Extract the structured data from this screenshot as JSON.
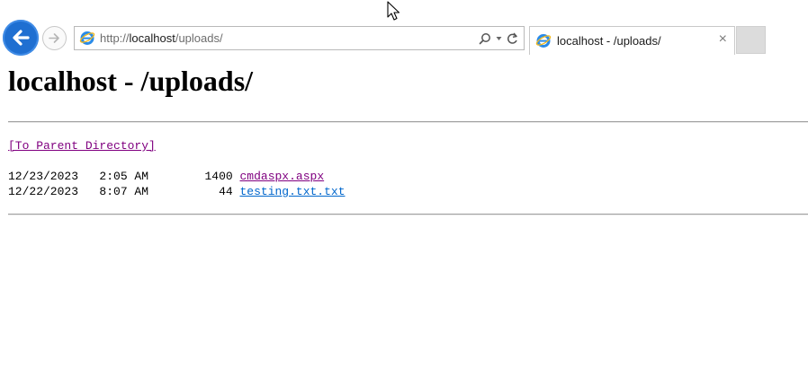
{
  "browser": {
    "address": {
      "scheme": "http://",
      "host": "localhost",
      "path": "/uploads/"
    },
    "tab": {
      "title": "localhost - /uploads/",
      "close_glyph": "×"
    },
    "icons": {
      "back": "back-arrow-icon",
      "forward": "forward-arrow-icon",
      "site": "ie-logo-icon",
      "search": "search-icon",
      "refresh": "refresh-icon",
      "dropdown": "dropdown-caret-icon"
    },
    "colors": {
      "back_button": "#1f6fd1",
      "new_tab": "#dcdcdc"
    }
  },
  "page": {
    "title": "localhost - /uploads/",
    "parent_link": "[To Parent Directory]",
    "files": [
      {
        "date": "12/23/2023",
        "time": " 2:05 AM",
        "size": "1400",
        "name": "cmdaspx.aspx",
        "visited": true
      },
      {
        "date": "12/22/2023",
        "time": " 8:07 AM",
        "size": "44",
        "name": "testing.txt.txt",
        "visited": false
      }
    ],
    "colors": {
      "visited_link": "#800080",
      "link": "#0066cc"
    }
  }
}
